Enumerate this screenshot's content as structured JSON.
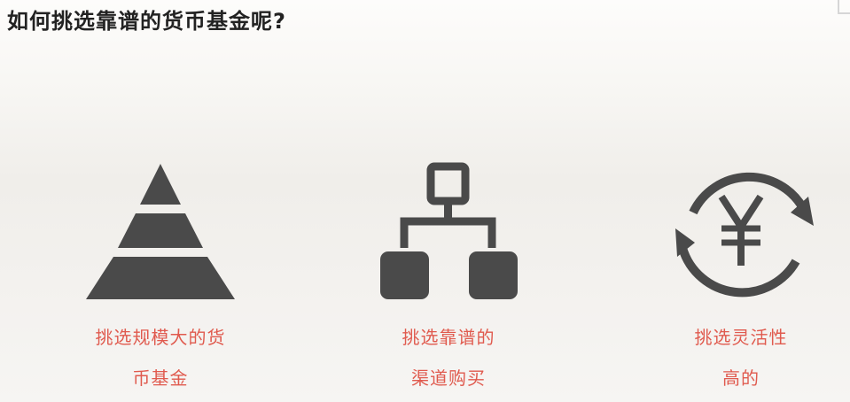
{
  "slide": {
    "title": "如何挑选靠谱的货币基金呢?"
  },
  "items": [
    {
      "icon": "pyramid-icon",
      "caption_line1": "挑选规模大的货",
      "caption_line2": "币基金"
    },
    {
      "icon": "hierarchy-network-icon",
      "caption_line1": "挑选靠谱的",
      "caption_line2": "渠道购买"
    },
    {
      "icon": "yuan-exchange-icon",
      "caption_line1": "挑选灵活性",
      "caption_line2": "高的"
    }
  ],
  "colors": {
    "icon": "#4a4a4a",
    "caption": "#e05a4e",
    "title": "#222222"
  }
}
